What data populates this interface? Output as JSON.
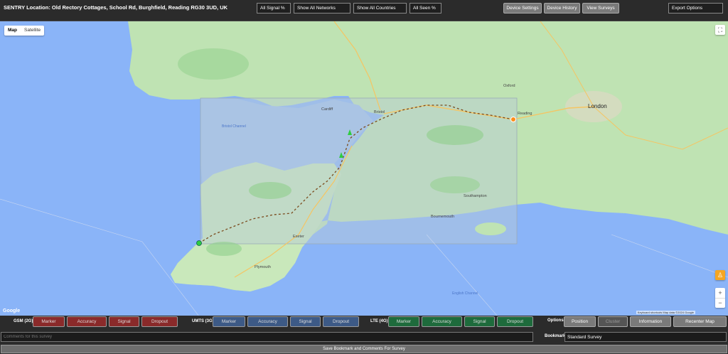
{
  "header": {
    "title": "SENTRY Location: Old Rectory Cottages, School Rd, Burghfield, Reading RG30 3UD, UK",
    "filters": {
      "signal": "All Signal %",
      "networks": "Show All Networks",
      "countries": "Show All Countries",
      "seen": "All Seen %"
    },
    "buttons": {
      "device_settings": "Device Settings",
      "device_history": "Device History",
      "view_surveys": "View Surveys"
    },
    "export": "Export Options"
  },
  "map": {
    "toggle_map": "Map",
    "toggle_satellite": "Satellite",
    "zoom_in": "+",
    "zoom_out": "−",
    "fullscreen_icon": "fullscreen-icon",
    "pegman_icon": "pegman-icon",
    "attribution": "Keyboard shortcuts   Map data ©2024 Google",
    "logo": "Google",
    "labels": {
      "london": "London",
      "reading": "Reading",
      "bristol": "Bristol",
      "cardiff": "Cardiff",
      "plymouth": "Plymouth",
      "southampton": "Southampton",
      "bournemouth": "Bournemouth",
      "oxford": "Oxford",
      "exeter": "Exeter",
      "bristol_channel": "Bristol Channel",
      "english_channel": "English Channel"
    },
    "colors": {
      "land": "#bfe3b3",
      "water": "#8ab4f8",
      "route": "#7a4a1c",
      "overlay": "#b7c9d6"
    }
  },
  "legend": {
    "gsm": {
      "label": "GSM (2G)",
      "marker": "Marker",
      "accuracy": "Accuracy",
      "signal": "Signal",
      "dropout": "Dropout"
    },
    "umts": {
      "label": "UMTS (3G)",
      "marker": "Marker",
      "accuracy": "Accuracy",
      "signal": "Signal",
      "dropout": "Dropout"
    },
    "lte": {
      "label": "LTE (4G)",
      "marker": "Marker",
      "accuracy": "Accuracy",
      "signal": "Signal",
      "dropout": "Dropout"
    },
    "options": {
      "label": "Options",
      "position": "Position",
      "cluster": "Cluster",
      "information": "Information",
      "recenter": "Recenter Map"
    }
  },
  "form": {
    "comments_placeholder": "Comments for this survey",
    "bookmark_label": "Bookmark",
    "bookmark_value": "Standard Survey",
    "save": "Save Bookmark and Comments For Survey"
  }
}
